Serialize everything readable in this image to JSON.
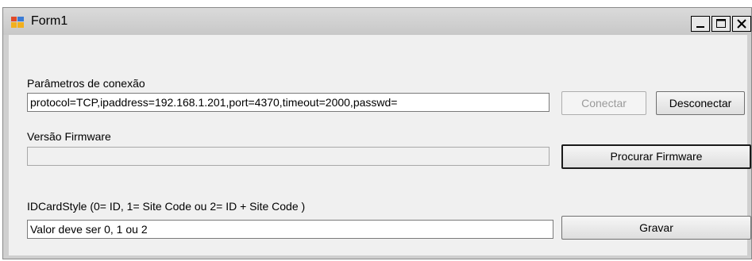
{
  "window": {
    "title": "Form1",
    "buttons": {
      "minimize": "minimize",
      "maximize": "maximize",
      "close": "close"
    }
  },
  "connection": {
    "label": "Parâmetros de conexão",
    "value": "protocol=TCP,ipaddress=192.168.1.201,port=4370,timeout=2000,passwd=",
    "connect_label": "Conectar",
    "disconnect_label": "Desconectar"
  },
  "firmware": {
    "label": "Versão Firmware",
    "value": "",
    "search_label": "Procurar Firmware"
  },
  "idcard": {
    "label": "IDCardStyle (0= ID, 1= Site Code ou 2= ID + Site Code )",
    "value": "Valor deve ser 0, 1 ou 2",
    "save_label": "Gravar"
  },
  "colors": {
    "client_bg": "#f0f0f0",
    "titlebar_bg": "#d0d0d0",
    "disabled_text": "#9a9a9a"
  }
}
